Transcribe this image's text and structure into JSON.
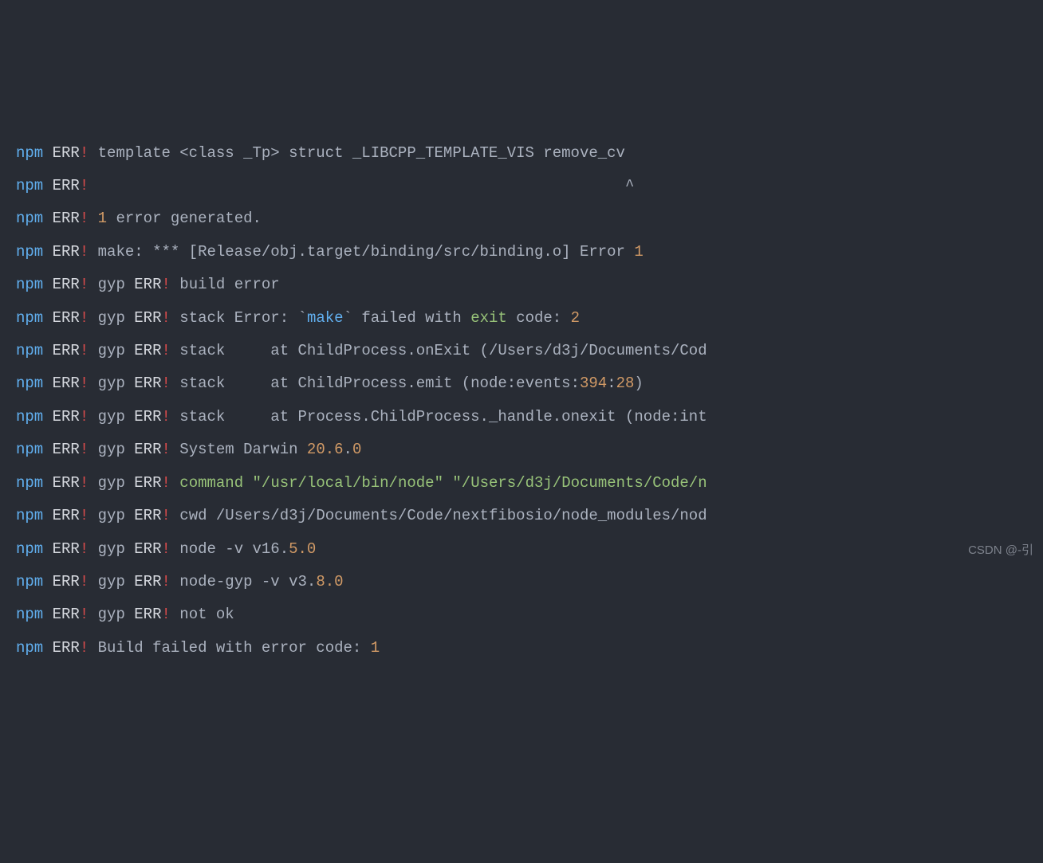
{
  "watermark": "CSDN @-引",
  "lines": [
    {
      "id": "l1",
      "segs": [
        {
          "cls": "npm",
          "t": "npm"
        },
        {
          "cls": "txt",
          "t": " "
        },
        {
          "cls": "err-white",
          "t": "ERR"
        },
        {
          "cls": "err-bang",
          "t": "!"
        },
        {
          "cls": "txt",
          "t": " template <class _Tp> struct _LIBCPP_TEMPLATE_VIS remove_cv"
        }
      ]
    },
    {
      "id": "l2",
      "segs": [
        {
          "cls": "npm",
          "t": "npm"
        },
        {
          "cls": "txt",
          "t": " "
        },
        {
          "cls": "err-white",
          "t": "ERR"
        },
        {
          "cls": "err-bang",
          "t": "!"
        },
        {
          "cls": "txt",
          "t": "                                                           ^"
        }
      ]
    },
    {
      "id": "l3",
      "segs": [
        {
          "cls": "npm",
          "t": "npm"
        },
        {
          "cls": "txt",
          "t": " "
        },
        {
          "cls": "err-white",
          "t": "ERR"
        },
        {
          "cls": "err-bang",
          "t": "!"
        },
        {
          "cls": "txt",
          "t": " "
        },
        {
          "cls": "num",
          "t": "1"
        },
        {
          "cls": "txt",
          "t": " error generated."
        }
      ]
    },
    {
      "id": "l4",
      "segs": [
        {
          "cls": "npm",
          "t": "npm"
        },
        {
          "cls": "txt",
          "t": " "
        },
        {
          "cls": "err-white",
          "t": "ERR"
        },
        {
          "cls": "err-bang",
          "t": "!"
        },
        {
          "cls": "txt",
          "t": " make: *** [Release/obj.target/binding/src/binding.o] Error "
        },
        {
          "cls": "num",
          "t": "1"
        }
      ]
    },
    {
      "id": "l5",
      "segs": [
        {
          "cls": "npm",
          "t": "npm"
        },
        {
          "cls": "txt",
          "t": " "
        },
        {
          "cls": "err-white",
          "t": "ERR"
        },
        {
          "cls": "err-bang",
          "t": "!"
        },
        {
          "cls": "txt",
          "t": " gyp "
        },
        {
          "cls": "gyp-err",
          "t": "ERR"
        },
        {
          "cls": "gyp-bang",
          "t": "!"
        },
        {
          "cls": "txt",
          "t": " build error "
        }
      ]
    },
    {
      "id": "l6",
      "segs": [
        {
          "cls": "npm",
          "t": "npm"
        },
        {
          "cls": "txt",
          "t": " "
        },
        {
          "cls": "err-white",
          "t": "ERR"
        },
        {
          "cls": "err-bang",
          "t": "!"
        },
        {
          "cls": "txt",
          "t": " gyp "
        },
        {
          "cls": "gyp-err",
          "t": "ERR"
        },
        {
          "cls": "gyp-bang",
          "t": "!"
        },
        {
          "cls": "txt",
          "t": " stack Error: "
        },
        {
          "cls": "tick",
          "t": "`"
        },
        {
          "cls": "kw-make",
          "t": "make"
        },
        {
          "cls": "tick",
          "t": "`"
        },
        {
          "cls": "txt",
          "t": " failed with "
        },
        {
          "cls": "kw-exit",
          "t": "exit"
        },
        {
          "cls": "txt",
          "t": " code: "
        },
        {
          "cls": "num",
          "t": "2"
        }
      ]
    },
    {
      "id": "l7",
      "segs": [
        {
          "cls": "npm",
          "t": "npm"
        },
        {
          "cls": "txt",
          "t": " "
        },
        {
          "cls": "err-white",
          "t": "ERR"
        },
        {
          "cls": "err-bang",
          "t": "!"
        },
        {
          "cls": "txt",
          "t": " gyp "
        },
        {
          "cls": "gyp-err",
          "t": "ERR"
        },
        {
          "cls": "gyp-bang",
          "t": "!"
        },
        {
          "cls": "txt",
          "t": " stack     at ChildProcess.onExit (/Users/d3j/Documents/Cod"
        }
      ]
    },
    {
      "id": "l8",
      "segs": [
        {
          "cls": "npm",
          "t": "npm"
        },
        {
          "cls": "txt",
          "t": " "
        },
        {
          "cls": "err-white",
          "t": "ERR"
        },
        {
          "cls": "err-bang",
          "t": "!"
        },
        {
          "cls": "txt",
          "t": " gyp "
        },
        {
          "cls": "gyp-err",
          "t": "ERR"
        },
        {
          "cls": "gyp-bang",
          "t": "!"
        },
        {
          "cls": "txt",
          "t": " stack     at ChildProcess.emit (node:events:"
        },
        {
          "cls": "num",
          "t": "394"
        },
        {
          "cls": "txt",
          "t": ":"
        },
        {
          "cls": "num",
          "t": "28"
        },
        {
          "cls": "txt",
          "t": ")"
        }
      ]
    },
    {
      "id": "l9",
      "segs": [
        {
          "cls": "npm",
          "t": "npm"
        },
        {
          "cls": "txt",
          "t": " "
        },
        {
          "cls": "err-white",
          "t": "ERR"
        },
        {
          "cls": "err-bang",
          "t": "!"
        },
        {
          "cls": "txt",
          "t": " gyp "
        },
        {
          "cls": "gyp-err",
          "t": "ERR"
        },
        {
          "cls": "gyp-bang",
          "t": "!"
        },
        {
          "cls": "txt",
          "t": " stack     at Process.ChildProcess._handle.onexit (node:int"
        }
      ]
    },
    {
      "id": "l10",
      "segs": [
        {
          "cls": "npm",
          "t": "npm"
        },
        {
          "cls": "txt",
          "t": " "
        },
        {
          "cls": "err-white",
          "t": "ERR"
        },
        {
          "cls": "err-bang",
          "t": "!"
        },
        {
          "cls": "txt",
          "t": " gyp "
        },
        {
          "cls": "gyp-err",
          "t": "ERR"
        },
        {
          "cls": "gyp-bang",
          "t": "!"
        },
        {
          "cls": "txt",
          "t": " System Darwin "
        },
        {
          "cls": "num",
          "t": "20.6"
        },
        {
          "cls": "txt",
          "t": "."
        },
        {
          "cls": "num",
          "t": "0"
        }
      ]
    },
    {
      "id": "l11",
      "segs": [
        {
          "cls": "npm",
          "t": "npm"
        },
        {
          "cls": "txt",
          "t": " "
        },
        {
          "cls": "err-white",
          "t": "ERR"
        },
        {
          "cls": "err-bang",
          "t": "!"
        },
        {
          "cls": "txt",
          "t": " gyp "
        },
        {
          "cls": "gyp-err",
          "t": "ERR"
        },
        {
          "cls": "gyp-bang",
          "t": "!"
        },
        {
          "cls": "txt",
          "t": " "
        },
        {
          "cls": "kw-exit",
          "t": "command"
        },
        {
          "cls": "txt",
          "t": " "
        },
        {
          "cls": "str",
          "t": "\"/usr/local/bin/node\""
        },
        {
          "cls": "txt",
          "t": " "
        },
        {
          "cls": "str",
          "t": "\"/Users/d3j/Documents/Code/n"
        }
      ]
    },
    {
      "id": "l12",
      "segs": [
        {
          "cls": "npm",
          "t": "npm"
        },
        {
          "cls": "txt",
          "t": " "
        },
        {
          "cls": "err-white",
          "t": "ERR"
        },
        {
          "cls": "err-bang",
          "t": "!"
        },
        {
          "cls": "txt",
          "t": " gyp "
        },
        {
          "cls": "gyp-err",
          "t": "ERR"
        },
        {
          "cls": "gyp-bang",
          "t": "!"
        },
        {
          "cls": "txt",
          "t": " cwd /Users/d3j/Documents/Code/nextfibosio/node_modules/nod"
        }
      ]
    },
    {
      "id": "l13",
      "segs": [
        {
          "cls": "npm",
          "t": "npm"
        },
        {
          "cls": "txt",
          "t": " "
        },
        {
          "cls": "err-white",
          "t": "ERR"
        },
        {
          "cls": "err-bang",
          "t": "!"
        },
        {
          "cls": "txt",
          "t": " gyp "
        },
        {
          "cls": "gyp-err",
          "t": "ERR"
        },
        {
          "cls": "gyp-bang",
          "t": "!"
        },
        {
          "cls": "txt",
          "t": " node -v v16."
        },
        {
          "cls": "num",
          "t": "5.0"
        }
      ]
    },
    {
      "id": "l14",
      "segs": [
        {
          "cls": "npm",
          "t": "npm"
        },
        {
          "cls": "txt",
          "t": " "
        },
        {
          "cls": "err-white",
          "t": "ERR"
        },
        {
          "cls": "err-bang",
          "t": "!"
        },
        {
          "cls": "txt",
          "t": " gyp "
        },
        {
          "cls": "gyp-err",
          "t": "ERR"
        },
        {
          "cls": "gyp-bang",
          "t": "!"
        },
        {
          "cls": "txt",
          "t": " node-gyp -v v3."
        },
        {
          "cls": "num",
          "t": "8.0"
        }
      ]
    },
    {
      "id": "l15",
      "segs": [
        {
          "cls": "npm",
          "t": "npm"
        },
        {
          "cls": "txt",
          "t": " "
        },
        {
          "cls": "err-white",
          "t": "ERR"
        },
        {
          "cls": "err-bang",
          "t": "!"
        },
        {
          "cls": "txt",
          "t": " gyp "
        },
        {
          "cls": "gyp-err",
          "t": "ERR"
        },
        {
          "cls": "gyp-bang",
          "t": "!"
        },
        {
          "cls": "txt",
          "t": " not ok "
        }
      ]
    },
    {
      "id": "l16",
      "segs": [
        {
          "cls": "npm",
          "t": "npm"
        },
        {
          "cls": "txt",
          "t": " "
        },
        {
          "cls": "err-white",
          "t": "ERR"
        },
        {
          "cls": "err-bang",
          "t": "!"
        },
        {
          "cls": "txt",
          "t": " Build failed with error code: "
        },
        {
          "cls": "num",
          "t": "1"
        }
      ]
    }
  ]
}
